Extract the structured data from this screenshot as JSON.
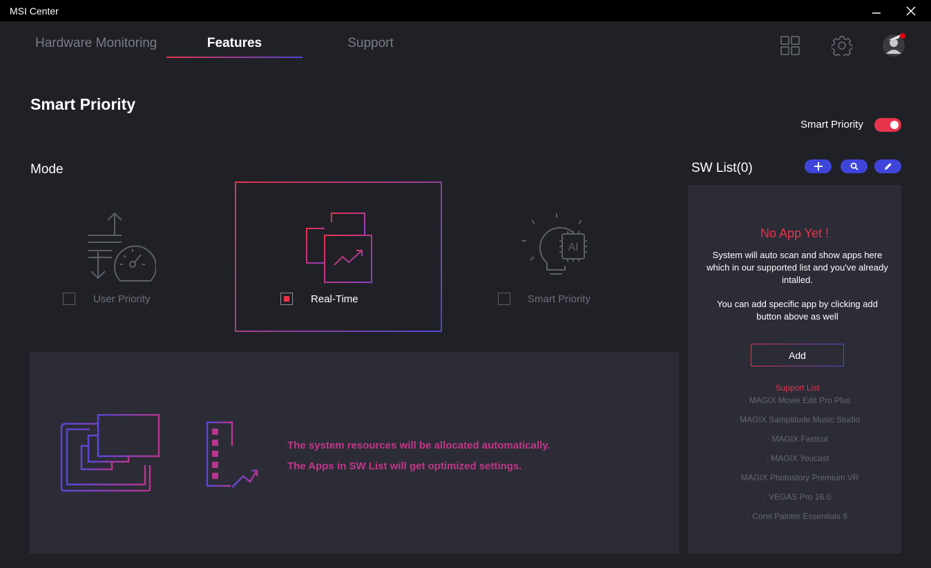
{
  "window": {
    "title": "MSI Center"
  },
  "tabs": [
    {
      "label": "Hardware Monitoring",
      "active": false
    },
    {
      "label": "Features",
      "active": true
    },
    {
      "label": "Support",
      "active": false
    }
  ],
  "top_icons": [
    "grid-icon",
    "gear-icon",
    "avatar"
  ],
  "page": {
    "title": "Smart Priority",
    "toggle_label": "Smart Priority",
    "toggle_on": true
  },
  "mode": {
    "label": "Mode",
    "options": [
      {
        "label": "User Priority",
        "checked": false,
        "icon": "speedometer-icon"
      },
      {
        "label": "Real-Time",
        "checked": true,
        "icon": "realtime-windows-icon"
      },
      {
        "label": "Smart Priority",
        "checked": false,
        "icon": "ai-bulb-icon"
      }
    ]
  },
  "info": {
    "line1": "The system resources will be allocated automatically.",
    "line2": "The Apps in SW List will get optimized settings."
  },
  "sw_list": {
    "title": "SW List(0)",
    "buttons": [
      "plus-icon",
      "search-icon",
      "edit-icon"
    ],
    "empty_title": "No App Yet !",
    "desc1": "System will auto scan and show apps here which in our supported list and you've already intalled.",
    "desc2": "You can add specific app by clicking add button above as well",
    "add_label": "Add",
    "support_title": "Support List",
    "support_items": [
      "· MAGIX Movie Edit Pro Plus",
      "· MAGIX Samplitude Music Studio",
      "· MAGIX Fastcut",
      "· MAGIX Youcast",
      "· MAGIX Photostory Premium VR",
      "· VEGAS Pro 16.0",
      "· Corel Painter Essentials 6"
    ]
  },
  "colors": {
    "accent_red": "#e8334d",
    "accent_blue": "#4f48d6",
    "accent_magenta": "#c2368a",
    "background": "#202127",
    "panel": "#2b2c36"
  }
}
